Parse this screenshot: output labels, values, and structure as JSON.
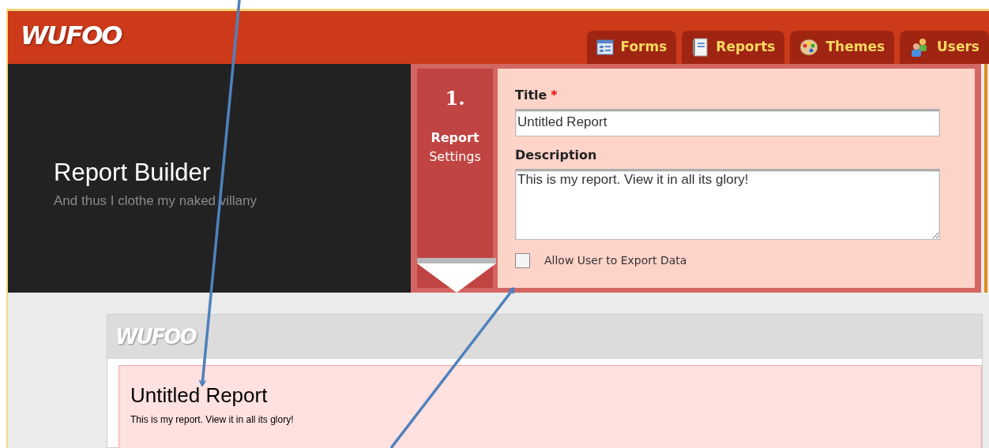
{
  "header": {
    "logo": "WUFOO",
    "tabs": [
      {
        "label": "Forms",
        "kind": "forms",
        "selected": false
      },
      {
        "label": "Reports",
        "kind": "reports",
        "selected": false
      },
      {
        "label": "Themes",
        "kind": "themes",
        "selected": false
      },
      {
        "label": "Users",
        "kind": "users",
        "selected": false
      }
    ]
  },
  "intro": {
    "title": "Report Builder",
    "subtitle": "And thus I clothe my naked villany"
  },
  "step": {
    "number": "1.",
    "title": "Report",
    "subtitle": "Settings"
  },
  "settings": {
    "title_label": "Title",
    "required_mark": "*",
    "title_value": "Untitled Report",
    "description_label": "Description",
    "description_value": "This is my report. View it in all its glory!",
    "export": {
      "label": "Allow User to Export Data",
      "checked": false
    }
  },
  "preview": {
    "logo": "WUFOO",
    "title": "Untitled Report",
    "description": "This is my report. View it in all its glory!"
  }
}
